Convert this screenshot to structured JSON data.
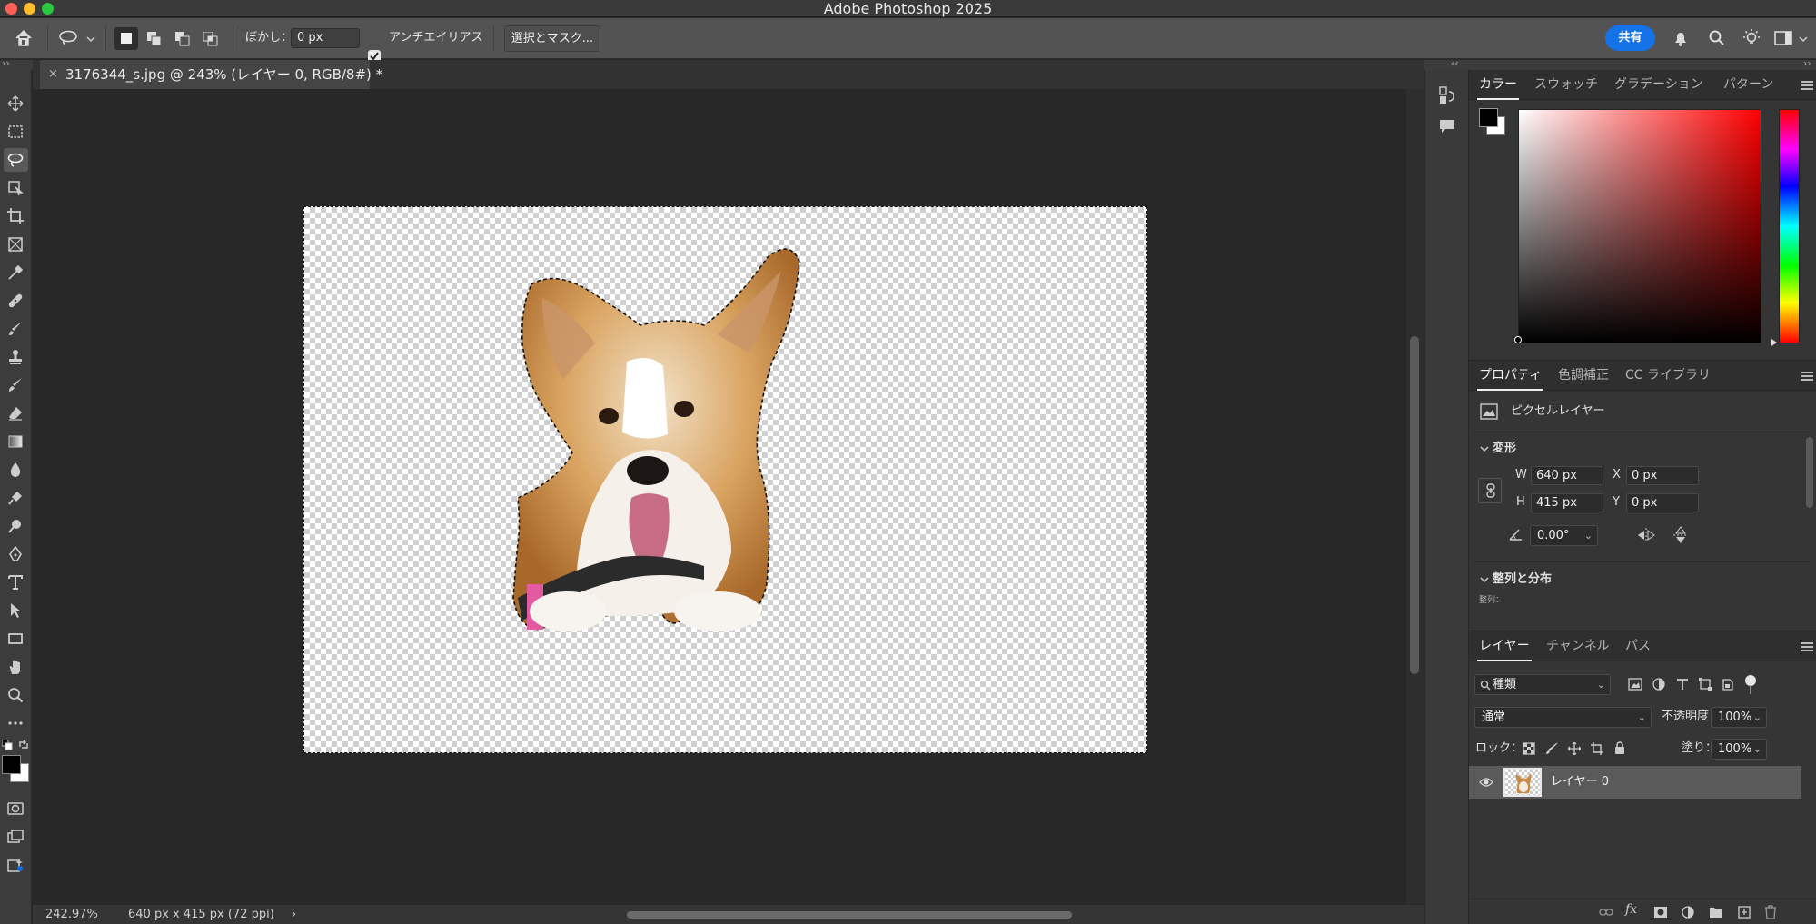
{
  "window": {
    "title": "Adobe Photoshop 2025"
  },
  "options_bar": {
    "feather_label": "ぼかし：",
    "feather_value": "0 px",
    "antialias_label": "アンチエイリアス",
    "antialias_checked": true,
    "select_mask_label": "選択とマスク...",
    "share_label": "共有"
  },
  "document": {
    "tab_title": "3176344_s.jpg @ 243% (レイヤー 0, RGB/8#) *",
    "close_glyph": "×"
  },
  "status_bar": {
    "zoom": "242.97%",
    "doc_info": "640 px x 415 px (72 ppi)",
    "arrow": "›"
  },
  "color_panel": {
    "tabs": [
      "カラー",
      "スウォッチ",
      "グラデーション",
      "パターン"
    ],
    "active_tab": 0,
    "hue_color": "#ff0000",
    "foreground": "#000000",
    "background": "#ffffff"
  },
  "properties_panel": {
    "tabs": [
      "プロパティ",
      "色調補正",
      "CC ライブラリ"
    ],
    "active_tab": 0,
    "layer_kind": "ピクセルレイヤー",
    "transform_section": "変形",
    "w_label": "W",
    "w_value": "640 px",
    "h_label": "H",
    "h_value": "415 px",
    "x_label": "X",
    "x_value": "0 px",
    "y_label": "Y",
    "y_value": "0 px",
    "angle_value": "0.00°",
    "align_section": "整列と分布",
    "align_sub": "整列："
  },
  "layers_panel": {
    "tabs": [
      "レイヤー",
      "チャンネル",
      "パス"
    ],
    "active_tab": 0,
    "filter_kind": "種類",
    "blend_mode": "通常",
    "opacity_label": "不透明度：",
    "opacity_value": "100%",
    "lock_label": "ロック：",
    "fill_label": "塗り：",
    "fill_value": "100%",
    "layers": [
      {
        "name": "レイヤー 0",
        "visible": true
      }
    ]
  },
  "toolbar": {
    "tools": [
      "move-tool",
      "marquee-tool",
      "lasso-tool",
      "object-select-tool",
      "crop-tool",
      "frame-tool",
      "eyedropper-tool",
      "healing-brush-tool",
      "brush-tool",
      "clone-stamp-tool",
      "history-brush-tool",
      "eraser-tool",
      "gradient-tool",
      "blur-tool",
      "smudge-tool",
      "dodge-tool",
      "pen-tool",
      "type-tool",
      "path-select-tool",
      "rectangle-tool",
      "hand-tool",
      "zoom-tool",
      "more-tools"
    ],
    "active_tool": "lasso-tool"
  }
}
